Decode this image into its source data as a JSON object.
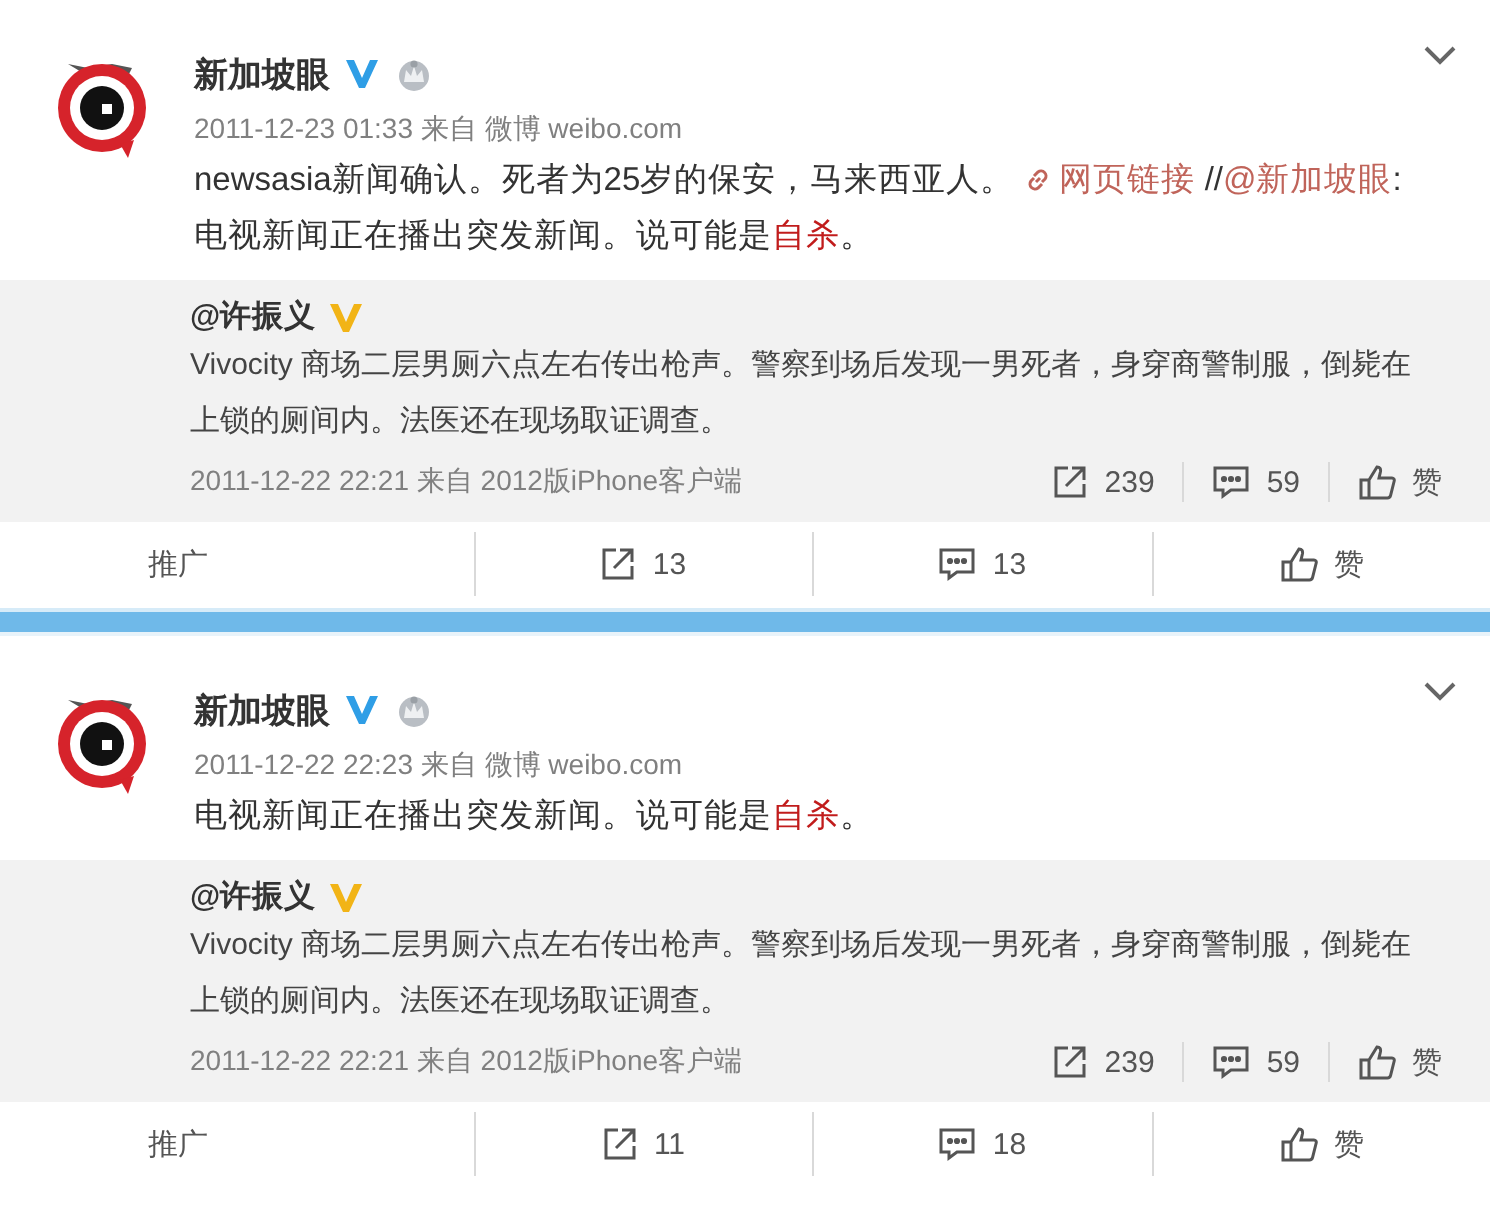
{
  "posts": [
    {
      "author": "新加坡眼",
      "verified_badge": {
        "color": "#2f9ee6"
      },
      "member_badge": true,
      "meta": "2011-12-23 01:33 来自 微博 weibo.com",
      "content": [
        {
          "kind": "plain",
          "text": "newsasia新闻确认。死者为25岁的保安，马来西亚人。 "
        },
        {
          "kind": "link",
          "text": "网页链接"
        },
        {
          "kind": "plain",
          "text": " //"
        },
        {
          "kind": "mention",
          "text": "@新加坡眼"
        },
        {
          "kind": "plain",
          "text": ": 电视新闻正在播出突发新闻。说可能是"
        },
        {
          "kind": "highlight",
          "text": "自杀"
        },
        {
          "kind": "plain",
          "text": "。"
        }
      ],
      "quote": {
        "author": "@许振义",
        "verified_badge": {
          "color": "#f2b416"
        },
        "text": "Vivocity 商场二层男厕六点左右传出枪声。警察到场后发现一男死者，身穿商警制服，倒毙在上锁的厕间内。法医还在现场取证调查。",
        "meta": "2011-12-22 22:21 来自 2012版iPhone客户端",
        "actions": [
          {
            "kind": "repost",
            "label": "239"
          },
          {
            "kind": "comment",
            "label": "59"
          },
          {
            "kind": "like",
            "label": "赞"
          }
        ]
      },
      "actions": [
        {
          "kind": "text",
          "label": "推广"
        },
        {
          "kind": "repost",
          "label": "13"
        },
        {
          "kind": "comment",
          "label": "13"
        },
        {
          "kind": "like",
          "label": "赞"
        }
      ]
    },
    {
      "author": "新加坡眼",
      "verified_badge": {
        "color": "#2f9ee6"
      },
      "member_badge": true,
      "meta": "2011-12-22 22:23 来自 微博 weibo.com",
      "content": [
        {
          "kind": "plain",
          "text": "电视新闻正在播出突发新闻。说可能是"
        },
        {
          "kind": "highlight",
          "text": "自杀"
        },
        {
          "kind": "plain",
          "text": "。"
        }
      ],
      "quote": {
        "author": "@许振义",
        "verified_badge": {
          "color": "#f2b416"
        },
        "text": "Vivocity 商场二层男厕六点左右传出枪声。警察到场后发现一男死者，身穿商警制服，倒毙在上锁的厕间内。法医还在现场取证调查。",
        "meta": "2011-12-22 22:21 来自 2012版iPhone客户端",
        "actions": [
          {
            "kind": "repost",
            "label": "239"
          },
          {
            "kind": "comment",
            "label": "59"
          },
          {
            "kind": "like",
            "label": "赞"
          }
        ]
      },
      "actions": [
        {
          "kind": "text",
          "label": "推广"
        },
        {
          "kind": "repost",
          "label": "11"
        },
        {
          "kind": "comment",
          "label": "18"
        },
        {
          "kind": "like",
          "label": "赞"
        }
      ]
    }
  ]
}
